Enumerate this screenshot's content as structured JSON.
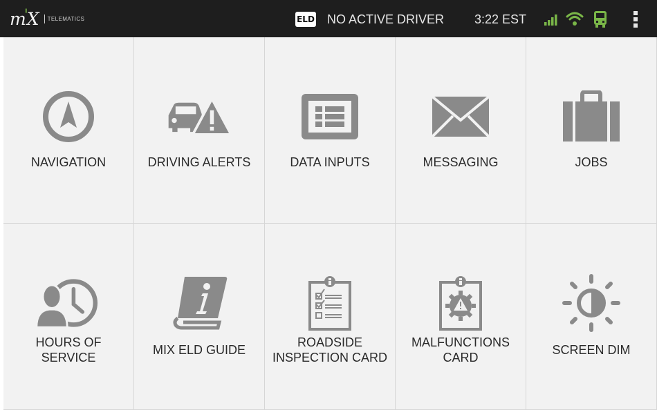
{
  "status_bar": {
    "logo_mark": "mix",
    "logo_text": "TELEMATICS",
    "eld_badge": "ELD",
    "driver_status": "NO ACTIVE DRIVER",
    "time": "3:22 EST",
    "icons": [
      "signal-icon",
      "wifi-icon",
      "truck-icon",
      "overflow-menu-icon"
    ],
    "accent_color": "#7ab648"
  },
  "tiles": [
    {
      "label": "NAVIGATION",
      "icon": "navigation-icon"
    },
    {
      "label": "DRIVING ALERTS",
      "icon": "driving-alerts-icon"
    },
    {
      "label": "DATA INPUTS",
      "icon": "data-inputs-icon"
    },
    {
      "label": "MESSAGING",
      "icon": "envelope-icon"
    },
    {
      "label": "JOBS",
      "icon": "briefcase-icon"
    },
    {
      "label": "HOURS OF\nSERVICE",
      "icon": "hours-of-service-icon"
    },
    {
      "label": "MIX ELD GUIDE",
      "icon": "guide-book-icon"
    },
    {
      "label": "ROADSIDE\nINSPECTION CARD",
      "icon": "inspection-card-icon"
    },
    {
      "label": "MALFUNCTIONS\nCARD",
      "icon": "malfunctions-card-icon"
    },
    {
      "label": "SCREEN DIM",
      "icon": "brightness-icon"
    }
  ],
  "colors": {
    "icon_gray": "#8a8a8a",
    "tile_background": "#f2f2f2",
    "status_bar": "#1e1e1e"
  }
}
